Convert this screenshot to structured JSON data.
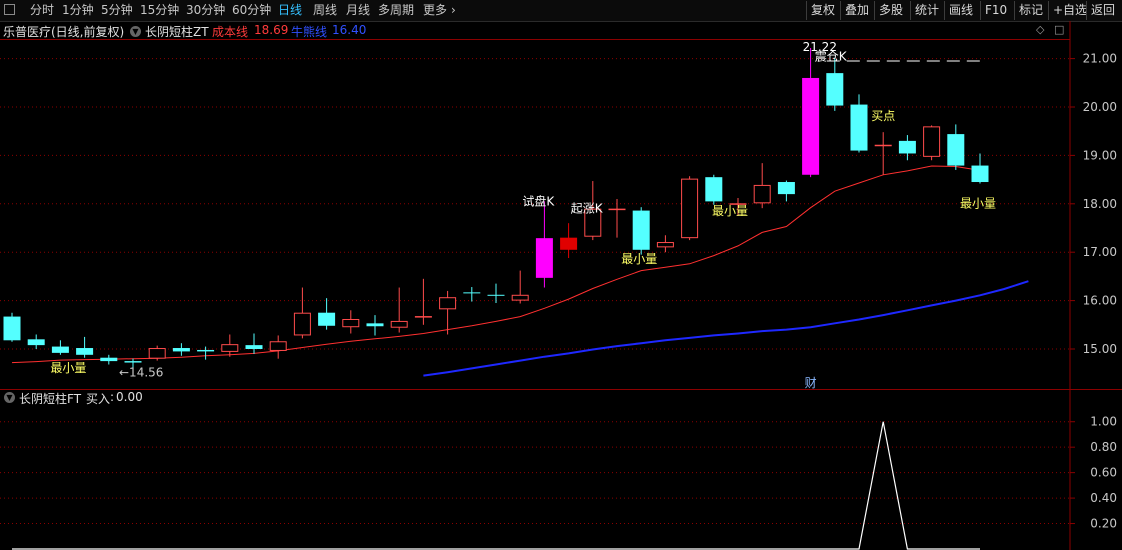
{
  "toolbar": {
    "periods": [
      "分时",
      "1分钟",
      "5分钟",
      "15分钟",
      "30分钟",
      "60分钟",
      "日线",
      "周线",
      "月线",
      "多周期",
      "更多"
    ],
    "active_period": "日线",
    "right_buttons": [
      "复权",
      "叠加",
      "多股",
      "统计",
      "画线",
      "F10",
      "标记",
      "+自选",
      "返回"
    ]
  },
  "header": {
    "title": "乐普医疗(日线,前复权)",
    "indicator": "长阴短柱ZT",
    "cost_label": "成本线",
    "cost_value": "18.69",
    "bull_label": "牛熊线",
    "bull_value": "16.40"
  },
  "sub_header": {
    "indicator": "长阴短柱FT",
    "buy_label": "买入",
    "buy_value": "0.00"
  },
  "colors": {
    "up": "#ff4c4c",
    "down": "#54ffff",
    "special_up": "#ff00ff",
    "special_down": "#e00000",
    "cost_line": "#ff3030",
    "bull_line": "#1e28ff",
    "annotation": "#ffff66",
    "grid": "#8b0000",
    "axis_text": "#c8c8c8",
    "signal": "#ffffff"
  },
  "chart_data": {
    "type": "candlestick",
    "ylim": [
      14.4,
      21.5
    ],
    "yticks": [
      "21.00",
      "20.00",
      "19.00",
      "18.00",
      "17.00",
      "16.00",
      "15.00"
    ],
    "candles": [
      {
        "o": 15.67,
        "c": 15.18,
        "h": 15.75,
        "l": 15.15,
        "color": "down"
      },
      {
        "o": 15.2,
        "c": 15.08,
        "h": 15.3,
        "l": 15.0,
        "color": "down"
      },
      {
        "o": 15.05,
        "c": 14.92,
        "h": 15.18,
        "l": 14.88,
        "color": "down"
      },
      {
        "o": 15.02,
        "c": 14.88,
        "h": 15.25,
        "l": 14.82,
        "color": "down"
      },
      {
        "o": 14.82,
        "c": 14.75,
        "h": 14.88,
        "l": 14.68,
        "color": "down"
      },
      {
        "o": 14.75,
        "c": 14.72,
        "h": 14.8,
        "l": 14.56,
        "color": "down"
      },
      {
        "o": 14.8,
        "c": 15.02,
        "h": 15.07,
        "l": 14.76,
        "color": "up"
      },
      {
        "o": 15.02,
        "c": 14.95,
        "h": 15.12,
        "l": 14.86,
        "color": "down"
      },
      {
        "o": 14.98,
        "c": 14.95,
        "h": 15.05,
        "l": 14.78,
        "color": "down"
      },
      {
        "o": 14.94,
        "c": 15.1,
        "h": 15.3,
        "l": 14.84,
        "color": "up"
      },
      {
        "o": 15.08,
        "c": 15.0,
        "h": 15.32,
        "l": 14.9,
        "color": "down"
      },
      {
        "o": 14.96,
        "c": 15.16,
        "h": 15.28,
        "l": 14.8,
        "color": "up"
      },
      {
        "o": 15.28,
        "c": 15.75,
        "h": 16.27,
        "l": 15.22,
        "color": "up"
      },
      {
        "o": 15.75,
        "c": 15.48,
        "h": 16.05,
        "l": 15.4,
        "color": "down"
      },
      {
        "o": 15.45,
        "c": 15.62,
        "h": 15.8,
        "l": 15.32,
        "color": "up"
      },
      {
        "o": 15.53,
        "c": 15.47,
        "h": 15.7,
        "l": 15.28,
        "color": "down"
      },
      {
        "o": 15.44,
        "c": 15.58,
        "h": 16.27,
        "l": 15.34,
        "color": "up"
      },
      {
        "o": 15.67,
        "c": 15.68,
        "h": 16.45,
        "l": 15.5,
        "color": "up"
      },
      {
        "o": 15.82,
        "c": 16.07,
        "h": 16.2,
        "l": 15.3,
        "color": "up"
      },
      {
        "o": 16.17,
        "c": 16.16,
        "h": 16.28,
        "l": 15.98,
        "color": "down"
      },
      {
        "o": 16.1,
        "c": 16.12,
        "h": 16.35,
        "l": 15.95,
        "color": "down"
      },
      {
        "o": 16.0,
        "c": 16.12,
        "h": 16.62,
        "l": 15.94,
        "color": "up"
      },
      {
        "o": 16.47,
        "c": 17.29,
        "h": 18.05,
        "l": 16.27,
        "color": "special_up"
      },
      {
        "o": 17.3,
        "c": 17.05,
        "h": 17.6,
        "l": 16.88,
        "color": "special_down"
      },
      {
        "o": 17.32,
        "c": 17.9,
        "h": 18.47,
        "l": 17.25,
        "color": "up"
      },
      {
        "o": 17.88,
        "c": 17.9,
        "h": 18.1,
        "l": 17.3,
        "color": "up"
      },
      {
        "o": 17.86,
        "c": 17.05,
        "h": 17.93,
        "l": 16.95,
        "color": "down"
      },
      {
        "o": 17.1,
        "c": 17.21,
        "h": 17.35,
        "l": 17.0,
        "color": "up"
      },
      {
        "o": 17.29,
        "c": 18.52,
        "h": 18.57,
        "l": 17.25,
        "color": "up"
      },
      {
        "o": 18.55,
        "c": 18.05,
        "h": 18.6,
        "l": 17.98,
        "color": "down"
      },
      {
        "o": 17.99,
        "c": 18.01,
        "h": 18.12,
        "l": 17.75,
        "color": "up"
      },
      {
        "o": 18.01,
        "c": 18.39,
        "h": 18.84,
        "l": 17.91,
        "color": "up"
      },
      {
        "o": 18.45,
        "c": 18.2,
        "h": 18.48,
        "l": 18.05,
        "color": "down"
      },
      {
        "o": 18.6,
        "c": 20.6,
        "h": 21.22,
        "l": 18.55,
        "color": "special_up"
      },
      {
        "o": 20.7,
        "c": 20.03,
        "h": 21.02,
        "l": 19.92,
        "color": "down"
      },
      {
        "o": 20.05,
        "c": 19.1,
        "h": 20.26,
        "l": 19.06,
        "color": "down"
      },
      {
        "o": 19.2,
        "c": 19.22,
        "h": 19.48,
        "l": 18.6,
        "color": "up"
      },
      {
        "o": 19.3,
        "c": 19.04,
        "h": 19.42,
        "l": 18.9,
        "color": "down"
      },
      {
        "o": 18.97,
        "c": 19.6,
        "h": 19.62,
        "l": 18.9,
        "color": "up"
      },
      {
        "o": 19.44,
        "c": 18.79,
        "h": 19.64,
        "l": 18.7,
        "color": "down"
      },
      {
        "o": 18.79,
        "c": 18.45,
        "h": 19.04,
        "l": 18.42,
        "color": "down"
      }
    ],
    "cost_line": [
      14.72,
      14.74,
      14.77,
      14.78,
      14.79,
      14.8,
      14.81,
      14.83,
      14.86,
      14.88,
      14.91,
      14.96,
      15.03,
      15.1,
      15.16,
      15.21,
      15.26,
      15.32,
      15.4,
      15.48,
      15.57,
      15.67,
      15.84,
      16.03,
      16.25,
      16.44,
      16.62,
      16.69,
      16.76,
      16.93,
      17.13,
      17.41,
      17.53,
      17.92,
      18.26,
      18.43,
      18.6,
      18.68,
      18.78,
      18.77,
      18.69
    ],
    "bull_line": [
      14.45,
      14.52,
      14.6,
      14.68,
      14.76,
      14.84,
      14.91,
      14.99,
      15.06,
      15.12,
      15.18,
      15.23,
      15.28,
      15.32,
      15.37,
      15.4,
      15.45,
      15.53,
      15.61,
      15.7,
      15.8,
      15.9,
      16.0,
      16.11,
      16.24,
      16.4
    ],
    "bull_start_index": 17,
    "annotations": [
      {
        "text": "最小量",
        "index": 2
      },
      {
        "text": "←14.56",
        "index": 5
      },
      {
        "text": "试盘K",
        "index": 22
      },
      {
        "text": "起涨K",
        "index": 24
      },
      {
        "text": "最小量",
        "index": 26
      },
      {
        "text": "最小量",
        "index": 30
      },
      {
        "text": "21.22",
        "index": 33
      },
      {
        "text": "震仓K",
        "index": 34
      },
      {
        "text": "买点",
        "index": 36
      },
      {
        "text": "最小量",
        "index": 40
      },
      {
        "text": "财",
        "index": 33
      }
    ],
    "resistance_value": 20.95,
    "resistance_start_index": 34,
    "resistance_end_index": 40,
    "sub_chart": {
      "type": "line",
      "ylim": [
        0,
        1.1
      ],
      "yticks": [
        "1.00",
        "0.80",
        "0.60",
        "0.40",
        "0.20"
      ],
      "values": [
        0,
        0,
        0,
        0,
        0,
        0,
        0,
        0,
        0,
        0,
        0,
        0,
        0,
        0,
        0,
        0,
        0,
        0,
        0,
        0,
        0,
        0,
        0,
        0,
        0,
        0,
        0,
        0,
        0,
        0,
        0,
        0,
        0,
        0,
        0,
        0,
        1,
        0,
        0,
        0,
        0
      ]
    }
  }
}
